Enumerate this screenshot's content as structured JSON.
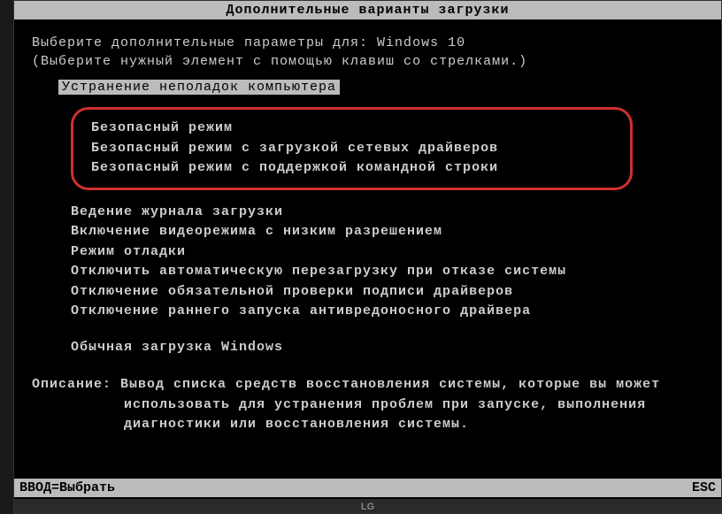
{
  "title": "Дополнительные варианты загрузки",
  "instruction1": "Выберите дополнительные параметры для: Windows 10",
  "instruction2": "(Выберите нужный элемент с помощью клавиш со стрелками.)",
  "selected_item": "Устранение неполадок компьютера",
  "safe_modes": {
    "m1": "Безопасный режим",
    "m2": "Безопасный режим с загрузкой сетевых драйверов",
    "m3": "Безопасный режим с поддержкой командной строки"
  },
  "menu_group2": {
    "i1": "Ведение журнала загрузки",
    "i2": "Включение видеорежима с низким разрешением",
    "i3": "Режим отладки",
    "i4": "Отключить автоматическую перезагрузку при отказе системы",
    "i5": "Отключение обязательной проверки подписи драйверов",
    "i6": "Отключение раннего запуска антивредоносного драйвера"
  },
  "menu_group3": {
    "i1": "Обычная загрузка Windows"
  },
  "description": {
    "label": "Описание:",
    "line1": "Вывод списка средств восстановления системы, которые вы может",
    "line2": "использовать для устранения проблем при запуске, выполнения",
    "line3": "диагностики или восстановления системы."
  },
  "footer": {
    "left": "ВВОД=Выбрать",
    "right": "ESC"
  },
  "monitor_brand": "LG"
}
